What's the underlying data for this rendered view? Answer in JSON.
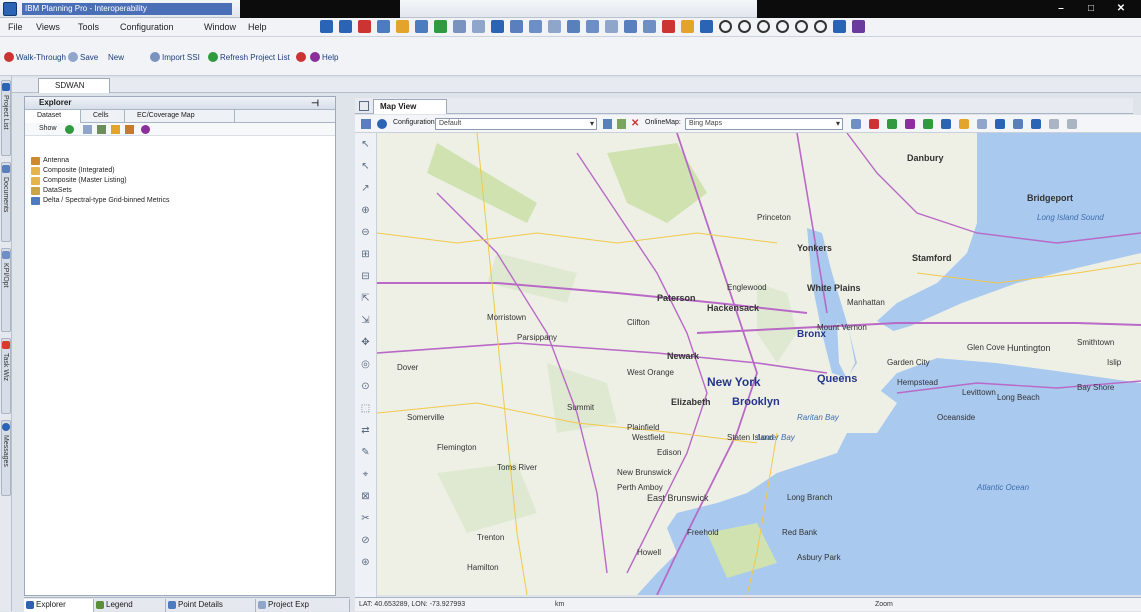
{
  "window": {
    "title": "IBM Planning Pro - Interoperability",
    "minimize": "–",
    "maximize": "□",
    "close": "✕"
  },
  "menubar": {
    "items": [
      "File",
      "Views",
      "Tools",
      "Configuration",
      "Window",
      "Help"
    ]
  },
  "toolbar2": {
    "walkthrough": "Walk-Through",
    "save": "Save",
    "new": "New",
    "import": "Import SSI",
    "refresh": "Refresh Project List",
    "help": "Help"
  },
  "project": {
    "tab": "SDWAN"
  },
  "leftdock": {
    "tabs": [
      "Project List",
      "Documents",
      "KPI/Opt",
      "Task Wiz",
      "Messages"
    ]
  },
  "explorer": {
    "title": "Explorer",
    "tabs": [
      "Dataset",
      "Cells",
      "EC/Coverage Map"
    ],
    "toolbar_label": "Show",
    "tree": [
      "Antenna",
      "Composite (Integrated)",
      "Composite (Master Listing)",
      "DataSets",
      "Delta / Spectral-type Grid-binned Metrics"
    ]
  },
  "mapview": {
    "title": "Map View",
    "configuration_label": "Configuration:",
    "configuration_value": "Default",
    "online_map_label": "OnlineMap:",
    "online_map_value": "Bing Maps"
  },
  "map_labels": {
    "cities": [
      "New York",
      "Brooklyn",
      "Queens",
      "Bronx",
      "Elizabeth",
      "Newark",
      "Paterson",
      "Hackensack",
      "Yonkers",
      "White Plains",
      "Stamford",
      "Bridgeport",
      "Danbury",
      "Mount Vernon",
      "Englewood",
      "Plainfield",
      "New Brunswick",
      "Edison",
      "East Brunswick",
      "Long Branch",
      "Howell",
      "Freehold",
      "Toms River",
      "Trenton",
      "Hamilton",
      "Princeton",
      "Manhattan",
      "Glen Cove",
      "Huntington",
      "Smithtown",
      "Hempstead",
      "Levittown",
      "Oceanside",
      "Long Beach",
      "West Orange",
      "Clifton",
      "Parsippany",
      "Morristown",
      "Dover",
      "Summit",
      "Westfield",
      "Somerville",
      "Flemington",
      "Asbury Park",
      "Red Bank",
      "Perth Amboy",
      "Staten Island",
      "Garden City",
      "Bay Shore",
      "Islip"
    ],
    "water": [
      "Long Island Sound",
      "Atlantic Ocean",
      "Raritan Bay",
      "Lower Bay"
    ]
  },
  "bottom_tabs": [
    "Explorer",
    "Legend",
    "Point Details",
    "Project Exp"
  ],
  "status": {
    "coords": "LAT: 40.653289, LON: -73.927993",
    "units": "km",
    "extra": "Zoom"
  },
  "colors": {
    "accent": "#2b63b5",
    "map_land": "#eef0e6",
    "map_water": "#a9c9ef",
    "map_park": "#cfe2b0",
    "major_road": "#b86ac6",
    "minor_road": "#f2c84b"
  }
}
